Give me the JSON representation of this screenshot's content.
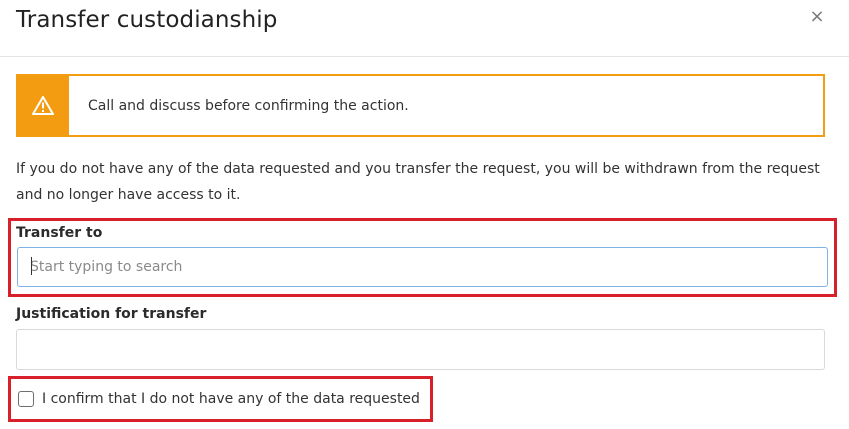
{
  "dialog": {
    "title": "Transfer custodianship",
    "close_symbol": "×"
  },
  "alert": {
    "icon": "warning-triangle-icon",
    "message": "Call and discuss before confirming the action.",
    "color": "#f39c12"
  },
  "info_text": "If you do not have any of the data requested and you transfer the request, you will be withdrawn from the request and no longer have access to it.",
  "transfer_to": {
    "label": "Transfer to",
    "placeholder": "Start typing to search",
    "value": ""
  },
  "justification": {
    "label": "Justification for transfer",
    "value": ""
  },
  "confirm": {
    "label": "I confirm that I do not have any of the data requested",
    "checked": false
  },
  "highlight_color": "#d8202a"
}
